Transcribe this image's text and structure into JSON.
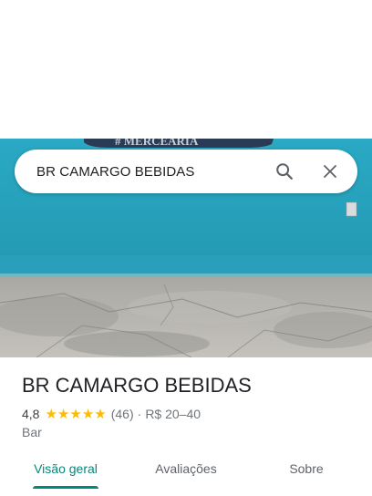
{
  "search": {
    "query": "BR CAMARGO BEBIDAS",
    "search_icon": "search-icon",
    "close_icon": "close-icon"
  },
  "photo": {
    "sign_text": "# MERCEARIA",
    "wall_color": "#2aa9c4",
    "floor_color": "#b5b3ad"
  },
  "place": {
    "title": "BR CAMARGO BEBIDAS",
    "rating": "4,8",
    "stars": 5,
    "reviews": "(46)",
    "separator": "·",
    "price": "R$ 20–40",
    "category": "Bar"
  },
  "tabs": [
    {
      "label": "Visão geral",
      "active": true
    },
    {
      "label": "Avaliações",
      "active": false
    },
    {
      "label": "Sobre",
      "active": false
    }
  ],
  "colors": {
    "accent": "#00897b",
    "star": "#fbbc04"
  }
}
